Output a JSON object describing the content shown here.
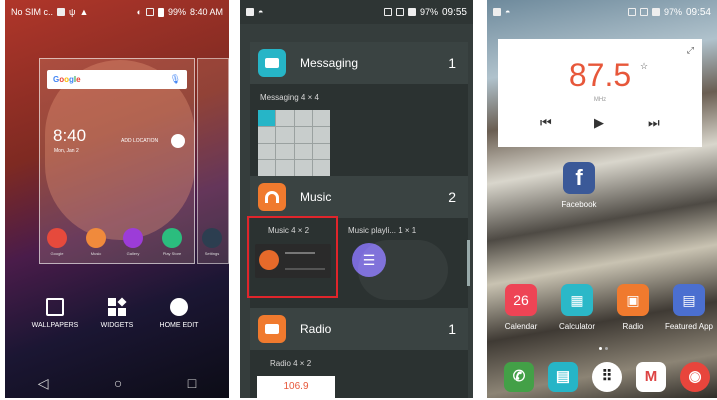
{
  "phone1": {
    "status": {
      "carrier": "No SIM c..",
      "battery": "99%",
      "time": "8:40 AM"
    },
    "search": {
      "brand": [
        "G",
        "o",
        "o",
        "g",
        "l",
        "e"
      ],
      "brand_colors": [
        "#4285f4",
        "#ea4335",
        "#fbbc05",
        "#4285f4",
        "#34a853",
        "#ea4335"
      ]
    },
    "clock": {
      "time": "8:40",
      "date": "Mon, Jan 2",
      "add_location": "ADD LOCATION"
    },
    "dock": [
      {
        "label": "Google",
        "color": "#e64a3c"
      },
      {
        "label": "Music",
        "color": "#f08a3c"
      },
      {
        "label": "Gallery",
        "color": "#9c3cd8"
      },
      {
        "label": "Play Store",
        "color": "#2bbd7e"
      },
      {
        "label": "Settings",
        "color": "#2c3e50"
      }
    ],
    "menu": {
      "wallpapers": "WALLPAPERS",
      "widgets": "WIDGETS",
      "home_edit": "HOME EDIT"
    }
  },
  "phone2": {
    "status": {
      "battery": "97%",
      "time": "09:55"
    },
    "messaging": {
      "name": "Messaging",
      "count": "1",
      "widget_label": "Messaging 4 × 4"
    },
    "music": {
      "name": "Music",
      "count": "2",
      "widget1_label": "Music  4 × 2",
      "widget2_label": "Music playli...  1 × 1"
    },
    "radio": {
      "name": "Radio",
      "count": "1",
      "widget_label": "Radio 4 × 2",
      "freq_preview": "106.9"
    },
    "colors": {
      "messaging": "#26b5c7",
      "music": "#f07a2e",
      "radio": "#f07a2e",
      "highlight": "#e0252b"
    }
  },
  "phone3": {
    "status": {
      "battery": "97%",
      "time": "09:54"
    },
    "radio": {
      "frequency": "87.5",
      "unit": "MHz"
    },
    "facebook_label": "Facebook",
    "apps": [
      {
        "label": "Calendar",
        "color": "#ee4455",
        "glyph": "26"
      },
      {
        "label": "Calculator",
        "color": "#2bb8c8",
        "glyph": "▦"
      },
      {
        "label": "Radio",
        "color": "#f07a2e",
        "glyph": "▣"
      },
      {
        "label": "Featured App",
        "color": "#4b6fd0",
        "glyph": "▤"
      }
    ],
    "dock": [
      {
        "name": "phone",
        "color": "#43a047",
        "glyph": "✆"
      },
      {
        "name": "messaging",
        "color": "#26b5c7",
        "glyph": "▤"
      },
      {
        "name": "apps",
        "color": "#ffffff",
        "glyph": "⠿"
      },
      {
        "name": "gmail",
        "color": "#ffffff",
        "glyph": "M"
      },
      {
        "name": "chrome",
        "color": "#e8453c",
        "glyph": "◉"
      }
    ]
  }
}
